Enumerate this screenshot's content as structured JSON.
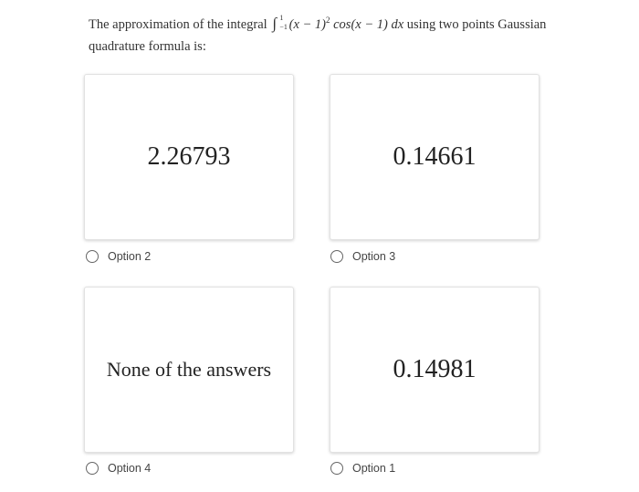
{
  "question": {
    "prefix": "The approximation of the integral",
    "upper": "1",
    "lower": "−1",
    "integrand_a": "(x − 1)",
    "power": "2",
    "integrand_b": " cos(x − 1) dx",
    "suffix": "using two points Gaussian quadrature formula is:"
  },
  "options": [
    {
      "value": "2.26793",
      "label": "Option 2"
    },
    {
      "value": "0.14661",
      "label": "Option 3"
    },
    {
      "value": "None of the answers",
      "label": "Option 4"
    },
    {
      "value": "0.14981",
      "label": "Option 1"
    }
  ]
}
